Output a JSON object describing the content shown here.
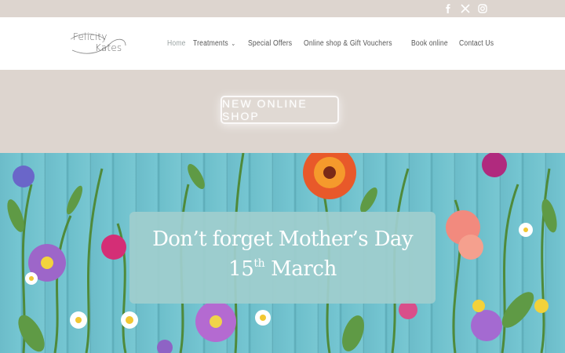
{
  "topbar": {
    "social": [
      {
        "icon": "facebook-icon",
        "glyph": "f"
      },
      {
        "icon": "x-twitter-icon",
        "glyph": "𝕏"
      },
      {
        "icon": "instagram-icon",
        "glyph": ""
      }
    ]
  },
  "header": {
    "logo": {
      "line1": "Felicity",
      "line2": "Kates"
    },
    "nav": [
      {
        "label": "Home",
        "active": true
      },
      {
        "label": "Treatments",
        "has_dropdown": true
      },
      {
        "label": "Special Offers"
      },
      {
        "label": "Online shop & Gift Vouchers"
      },
      {
        "label": "Book online"
      },
      {
        "label": "Contact Us"
      }
    ]
  },
  "promo": {
    "button_label": "NEW ONLINE SHOP"
  },
  "hero": {
    "headline": "Don’t forget Mother’s Day",
    "date_number": "15",
    "date_suffix": "th",
    "date_month": "March"
  },
  "colors": {
    "beige": "#ddd5cf",
    "card": "#9fcdcd",
    "wood": "#6cbcc9"
  }
}
